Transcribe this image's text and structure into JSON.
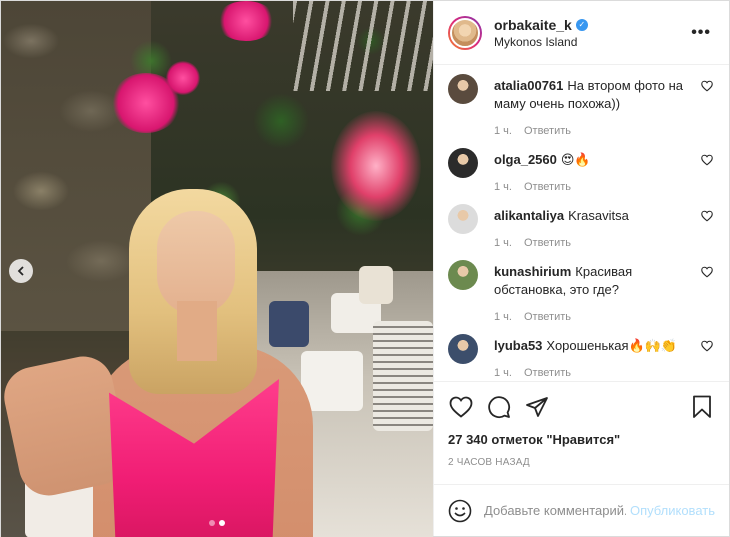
{
  "post": {
    "username": "orbakaite_k",
    "location": "Mykonos Island",
    "more_icon": "more-horizontal-icon"
  },
  "photo": {
    "slide_count": 2,
    "active_slide": 2,
    "prev_icon": "chevron-left-icon"
  },
  "comments": [
    {
      "user": "atalia00761",
      "text": "На втором фото на маму очень похожа))",
      "time": "1 ч.",
      "reply": "Ответить",
      "avatar_color": "#5a4b3e"
    },
    {
      "user": "olga_2560",
      "text": "😍🔥",
      "time": "1 ч.",
      "reply": "Ответить",
      "avatar_color": "#2b2b2b"
    },
    {
      "user": "alikantaliya",
      "text": "Krasavitsa",
      "time": "1 ч.",
      "reply": "Ответить",
      "avatar_color": "#dcdcdc"
    },
    {
      "user": "kunashirium",
      "text": "Красивая обстановка, это где?",
      "time": "1 ч.",
      "reply": "Ответить",
      "avatar_color": "#6c8a4f"
    },
    {
      "user": "lyuba53",
      "text": "Хорошенькая🔥🙌👏",
      "time": "1 ч.",
      "reply": "Ответить",
      "avatar_color": "#3c4e6b"
    }
  ],
  "actions": {
    "icons": [
      "heart-icon",
      "comment-icon",
      "share-icon",
      "bookmark-icon"
    ],
    "likes_count": "27 340 отметок",
    "likes_word": "\"Нравится\"",
    "posted": "2 часов назад"
  },
  "composer": {
    "placeholder": "Добавьте комментарий...",
    "publish": "Опубликовать",
    "emoji_icon": "emoji-icon"
  },
  "colors": {
    "verified": "#3897f0",
    "publish_disabled": "#b2dffc",
    "muted": "#8e8e8e"
  }
}
